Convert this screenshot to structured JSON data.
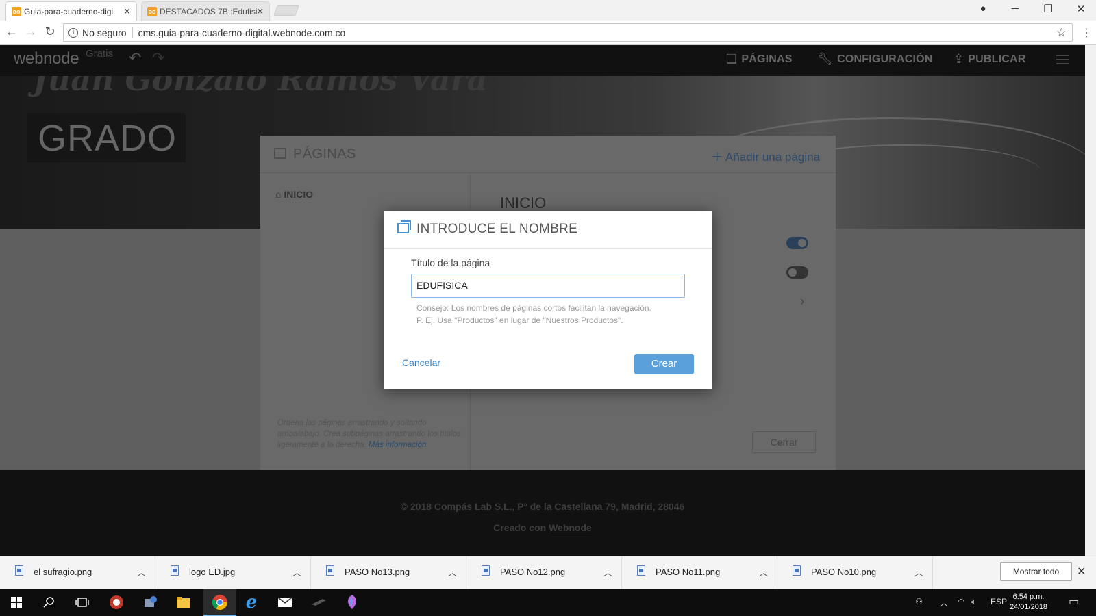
{
  "browser": {
    "tabs": [
      {
        "title": "Guia-para-cuaderno-digi",
        "active": true
      },
      {
        "title": "DESTACADOS 7B::Edufisi",
        "active": false
      }
    ],
    "security": "No seguro",
    "url": "cms.guia-para-cuaderno-digital.webnode.com.co"
  },
  "webnode_bar": {
    "logo": "webnode",
    "plan": "Gratis",
    "menu": [
      {
        "label": "PÁGINAS",
        "icon": "pages-icon"
      },
      {
        "label": "CONFIGURACIÓN",
        "icon": "wrench-icon"
      },
      {
        "label": "PUBLICAR",
        "icon": "upload-icon"
      }
    ]
  },
  "site": {
    "heading_script": "Juan Gonzalo Ramos Vara",
    "grade_box": "GRADO"
  },
  "pages_panel": {
    "title": "PÁGINAS",
    "add_page": "Añadir una página",
    "pages": [
      "INICIO"
    ],
    "selected_heading": "INICIO",
    "toggles": [
      true,
      false
    ],
    "hint": "Ordena las páginas arrastrando y soltando arriba/abajo. Crea subpáginas arrastrando los títulos ligeramente a la derecha.",
    "hint_link": "Más información.",
    "close_label": "Cerrar"
  },
  "modal": {
    "title": "INTRODUCE EL NOMBRE",
    "field_label": "Título de la página",
    "field_value": "EDUFISICA",
    "tip_line1": "Consejo: Los nombres de páginas cortos facilitan la navegación.",
    "tip_line2": "P. Ej. Usa \"Productos\" en lugar de \"Nuestros Productos\".",
    "cancel": "Cancelar",
    "create": "Crear"
  },
  "footer": {
    "copyright": "© 2018 Compás Lab S.L.,  Pº de la Castellana 79, Madrid, 28046",
    "created_prefix": "Creado con ",
    "created_link": "Webnode"
  },
  "downloads": {
    "files": [
      "el sufragio.png",
      "logo ED.jpg",
      "PASO No13.png",
      "PASO No12.png",
      "PASO No11.png",
      "PASO No10.png"
    ],
    "show_all": "Mostrar todo"
  },
  "taskbar": {
    "language": "ESP",
    "time": "6:54 p.m.",
    "date": "24/01/2018"
  }
}
